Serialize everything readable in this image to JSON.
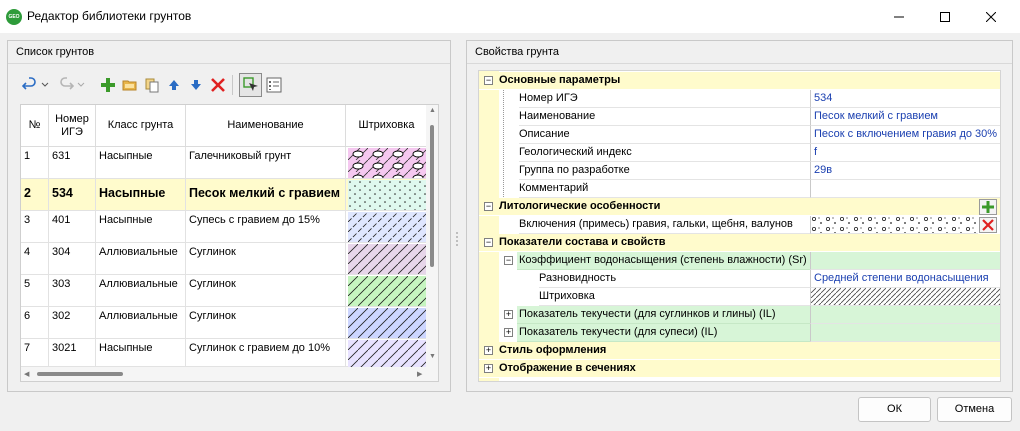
{
  "window": {
    "title": "Редактор библиотеки грунтов",
    "icon_text": "GEO",
    "buttons": [
      "minimize-button",
      "maximize-button",
      "close-button"
    ]
  },
  "left_panel": {
    "title": "Список грунтов",
    "toolbar": [
      "undo-icon",
      "dropdown-arrow-icon",
      "redo-icon",
      "dropdown-arrow-icon",
      "add-icon",
      "open-folder-icon",
      "copy-icon",
      "move-up-icon",
      "move-down-icon",
      "delete-icon",
      "select-active-icon",
      "properties-list-icon"
    ],
    "columns": [
      "№",
      "Номер ИГЭ",
      "Класс грунта",
      "Наименование",
      "Штриховка"
    ],
    "rows": [
      {
        "num": "1",
        "ige": "631",
        "class": "Насыпные",
        "name": "Галечниковый грунт",
        "hatch": "gravel-hatch"
      },
      {
        "num": "2",
        "ige": "534",
        "class": "Насыпные",
        "name": "Песок мелкий с гравием",
        "hatch": "dotted-sand-hatch"
      },
      {
        "num": "3",
        "ige": "401",
        "class": "Насыпные",
        "name": "Супесь с гравием до 15%",
        "hatch": "diagonal-blue-hatch"
      },
      {
        "num": "4",
        "ige": "304",
        "class": "Аллювиальные",
        "name": "Суглинок",
        "hatch": "diagonal-purple-hatch"
      },
      {
        "num": "5",
        "ige": "303",
        "class": "Аллювиальные",
        "name": "Суглинок",
        "hatch": "diagonal-green-hatch"
      },
      {
        "num": "6",
        "ige": "302",
        "class": "Аллювиальные",
        "name": "Суглинок",
        "hatch": "diagonal-blue-hatch"
      },
      {
        "num": "7",
        "ige": "3021",
        "class": "Насыпные",
        "name": "Суглинок с гравием до 10%",
        "hatch": "diagonal-lavender-hatch"
      }
    ],
    "selected_row": 2
  },
  "right_panel": {
    "title": "Свойства грунта",
    "basic": {
      "title": "Основные параметры",
      "fields": [
        {
          "label": "Номер ИГЭ",
          "value": "534"
        },
        {
          "label": "Наименование",
          "value": "Песок мелкий с гравием"
        },
        {
          "label": "Описание",
          "value": "Песок с включением гравия до 30%"
        },
        {
          "label": "Геологический индекс",
          "value": "f"
        },
        {
          "label": "Группа по разработке",
          "value": "29в"
        },
        {
          "label": "Комментарий",
          "value": ""
        }
      ]
    },
    "litho": {
      "title": "Литологические особенности",
      "inclusion_label": "Включения (примесь) гравия, гальки, щебня, валунов"
    },
    "composition": {
      "title": "Показатели состава и свойств",
      "saturation_label": "Коэффициент водонасыщения (степень влажности) (Sr)",
      "variety_label": "Разновидность",
      "variety_value": "Средней степени водонасыщения",
      "hatch_label": "Штриховка",
      "fluidity_clay_label": "Показатель текучести (для суглинков и глины) (IL)",
      "fluidity_sand_label": "Показатель текучести (для супеси) (IL)"
    },
    "style_title": "Стиль оформления",
    "sections_title": "Отображение в сечениях"
  },
  "footer": {
    "ok": "ОК",
    "cancel": "Отмена"
  },
  "colors": {
    "category_bg": "#fffbcc",
    "green_row_bg": "#d7f5d7",
    "value_text": "#1a3fb0",
    "selected_row_bg": "#fffbcc"
  }
}
